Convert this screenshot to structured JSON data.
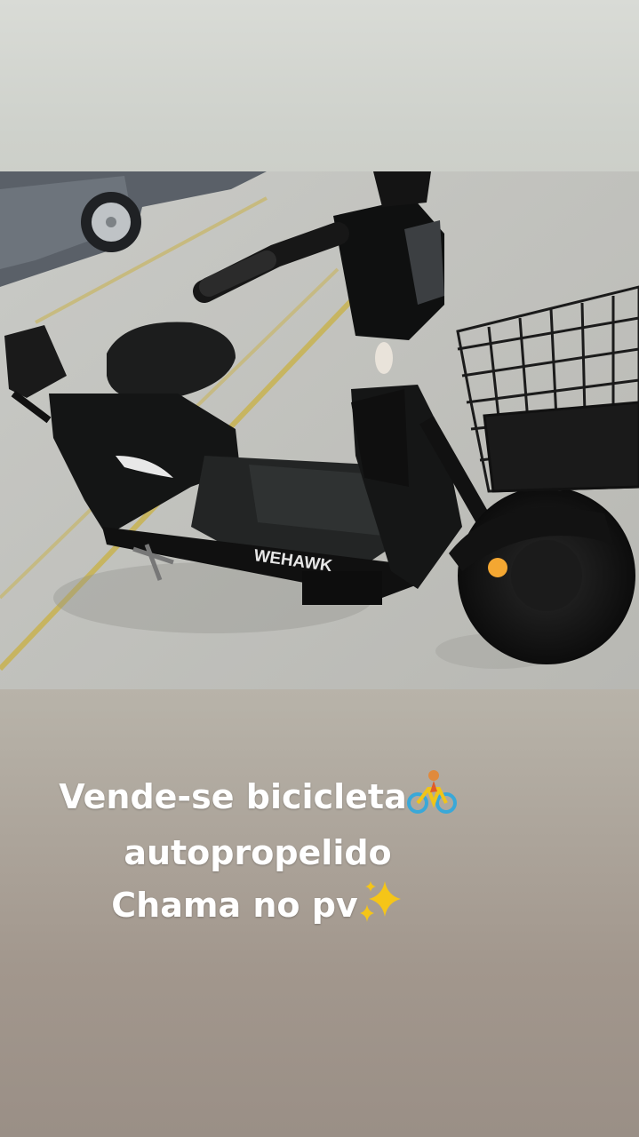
{
  "photo": {
    "subject": "electric scooter bicycle",
    "brand_text": "WEHAWK"
  },
  "caption": {
    "line1": "Vende-se bicicleta",
    "line1_emoji": "cyclist-icon",
    "line2": "autopropelido",
    "line3": "Chama no pv",
    "line3_emoji": "sparkles-icon"
  },
  "colors": {
    "background_top": "#d9dbd6",
    "background_bottom": "#9a8f86",
    "caption_text": "#ffffff"
  }
}
